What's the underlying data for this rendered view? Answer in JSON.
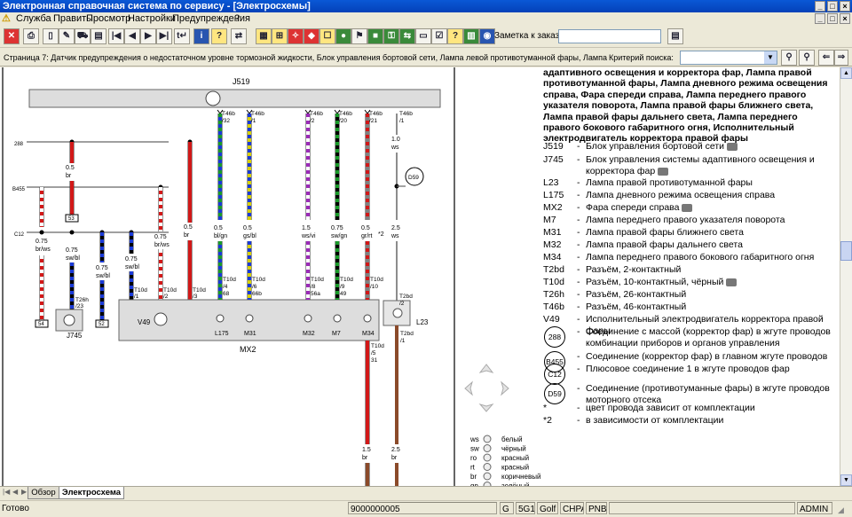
{
  "window": {
    "title": "Электронная справочная система по сервису - [Электросхемы]"
  },
  "menu": [
    "Служба",
    "Править",
    "Просмотр",
    "Настройки",
    "Предупреждения",
    "?"
  ],
  "toolbar": {
    "order_note_label": "Заметка к заказу:"
  },
  "infobar": {
    "page_text": "Страница 7: Датчик предупреждения о недостаточном уровне тормозной жидкости, Блок управления бортовой сети, Лампа левой противотуманной фары, Лампа",
    "search_label": "Критерий поиска:"
  },
  "description": "адаптивного освещения и корректора фар, Лампа правой противотуманной фары, Лампа дневного режима освещения справа, Фара спереди справа, Лампа переднего правого указателя поворота, Лампа правой фары ближнего света, Лампа правой фары дальнего света, Лампа переднего правого бокового габаритного огня, Исполнительный электродвигатель корректора правой фары",
  "legend": [
    {
      "code": "J519",
      "text": "Блок управления бортовой сети",
      "cam": true
    },
    {
      "code": "J745",
      "text": "Блок управления системы адаптивного освещения и корректора фар",
      "cam": true
    },
    {
      "code": "L23",
      "text": "Лампа правой противотуманной фары"
    },
    {
      "code": "L175",
      "text": "Лампа дневного режима освещения справа"
    },
    {
      "code": "MX2",
      "text": "Фара спереди справа",
      "cam": true
    },
    {
      "code": "M7",
      "text": "Лампа переднего правого указателя поворота"
    },
    {
      "code": "M31",
      "text": "Лампа правой фары ближнего света"
    },
    {
      "code": "M32",
      "text": "Лампа правой фары дальнего света"
    },
    {
      "code": "M34",
      "text": "Лампа переднего правого бокового габаритного огня"
    },
    {
      "code": "T2bd",
      "text": "Разъём, 2-контактный"
    },
    {
      "code": "T10d",
      "text": "Разъём, 10-контактный, чёрный",
      "cam": true
    },
    {
      "code": "T26h",
      "text": "Разъём, 26-контактный"
    },
    {
      "code": "T46b",
      "text": "Разъём, 46-контактный"
    },
    {
      "code": "V49",
      "text": "Исполнительный электродвигатель корректора правой фары"
    },
    {
      "code": "288",
      "text": "Соединение с массой (корректор фар) в жгуте проводов комбинации приборов и органов управления",
      "circle": true
    },
    {
      "code": "B455",
      "text": "Соединение (корректор фар) в главном жгуте проводов",
      "circle": true
    },
    {
      "code": "C12",
      "text": "Плюсовое соединение 1 в жгуте проводов фар",
      "circle": true
    },
    {
      "code": "D59",
      "text": "Соединение (противотуманные фары) в жгуте проводов моторного отсека",
      "circle": true
    },
    {
      "code": "*",
      "text": "цвет провода зависит от комплектации"
    },
    {
      "code": "*2",
      "text": "в зависимости от комплектации"
    }
  ],
  "color_legend": [
    {
      "code": "ws",
      "name": "белый"
    },
    {
      "code": "sw",
      "name": "чёрный"
    },
    {
      "code": "ro",
      "name": "красный"
    },
    {
      "code": "rt",
      "name": "красный"
    },
    {
      "code": "br",
      "name": "коричневый"
    },
    {
      "code": "gn",
      "name": "зелёный"
    }
  ],
  "diagram": {
    "j519": "J519",
    "j745": "J745",
    "mx2": "MX2",
    "v49": "V49",
    "l23": "L23",
    "bus_labels": [
      "288",
      "B455",
      "C12"
    ],
    "lamps": [
      "L175",
      "M31",
      "M32",
      "M7",
      "M34"
    ],
    "wires": [
      {
        "id": "w1",
        "conn_top": "T46b",
        "pin_top": "/32",
        "size": "0.5",
        "color": "bl/gn",
        "conn_bot": "T10d",
        "pin_bot": "/4",
        "pin_bot2": "68"
      },
      {
        "id": "w2",
        "conn_top": "T46b",
        "pin_top": "/1",
        "size": "0.5",
        "color": "gs/bl",
        "conn_bot": "T10d",
        "pin_bot": "/6",
        "pin_bot2": "66b"
      },
      {
        "id": "w3",
        "conn_top": "T46b",
        "pin_top": "/2",
        "size": "1.5",
        "color": "ws/vi",
        "conn_bot": "T10d",
        "pin_bot": "/8",
        "pin_bot2": "56a"
      },
      {
        "id": "w4",
        "conn_top": "T46b",
        "pin_top": "/20",
        "size": "0.75",
        "color": "sw/gn",
        "conn_bot": "T10d",
        "pin_bot": "/9",
        "pin_bot2": "49"
      },
      {
        "id": "w5",
        "conn_top": "T46b",
        "pin_top": "/21",
        "size": "0.5",
        "color": "gr/rt",
        "conn_bot": "T10d",
        "pin_bot": "/10",
        "pin_bot2": ""
      },
      {
        "id": "w6",
        "conn_top": "T46b",
        "pin_top": "/1",
        "size": "1.0",
        "color": "ws",
        "conn_bot": "T2bd",
        "pin_bot": "/2",
        "pin_bot2": ""
      }
    ],
    "left_wires": [
      {
        "size": "0.75",
        "color": "br/ws",
        "box": "54"
      },
      {
        "size": "0.5",
        "color": "br",
        "box": "53"
      },
      {
        "size": "0.75",
        "color": "sw/bl",
        "box": ""
      },
      {
        "size": "0.75",
        "color": "sw/bl",
        "box": "52"
      },
      {
        "size": "0.75",
        "color": "sw/bl",
        "box": ""
      },
      {
        "size": "0.75",
        "color": "br/ws",
        "box": ""
      },
      {
        "size": "0.5",
        "color": "br",
        "box": ""
      }
    ],
    "bottom_wires": [
      {
        "size": "1.5",
        "color": "br"
      },
      {
        "size": "2.5",
        "color": "br"
      }
    ],
    "extra_labels": {
      "d59": "D59",
      "t26h": "T26h",
      "t26h_pin": "/23",
      "t10d_v1": "/1",
      "t10d_v2": "/2",
      "t10d_v3": "/3",
      "m34_pin1": "/5",
      "m34_pin2": "31",
      "star2": "*2",
      "ws_label": "ws",
      "size25": "2.5",
      "t2bd1": "/1",
      "t2bd_bot": "T2bd"
    }
  },
  "tabs": {
    "overview": "Обзор",
    "scheme": "Электросхема"
  },
  "status": {
    "ready": "Готово",
    "code": "9000000005",
    "c1": "G",
    "c2": "5G1",
    "c3": "Golf",
    "c4": "CHPA",
    "c5": "PNB",
    "c6": "",
    "user": "ADMIN"
  }
}
